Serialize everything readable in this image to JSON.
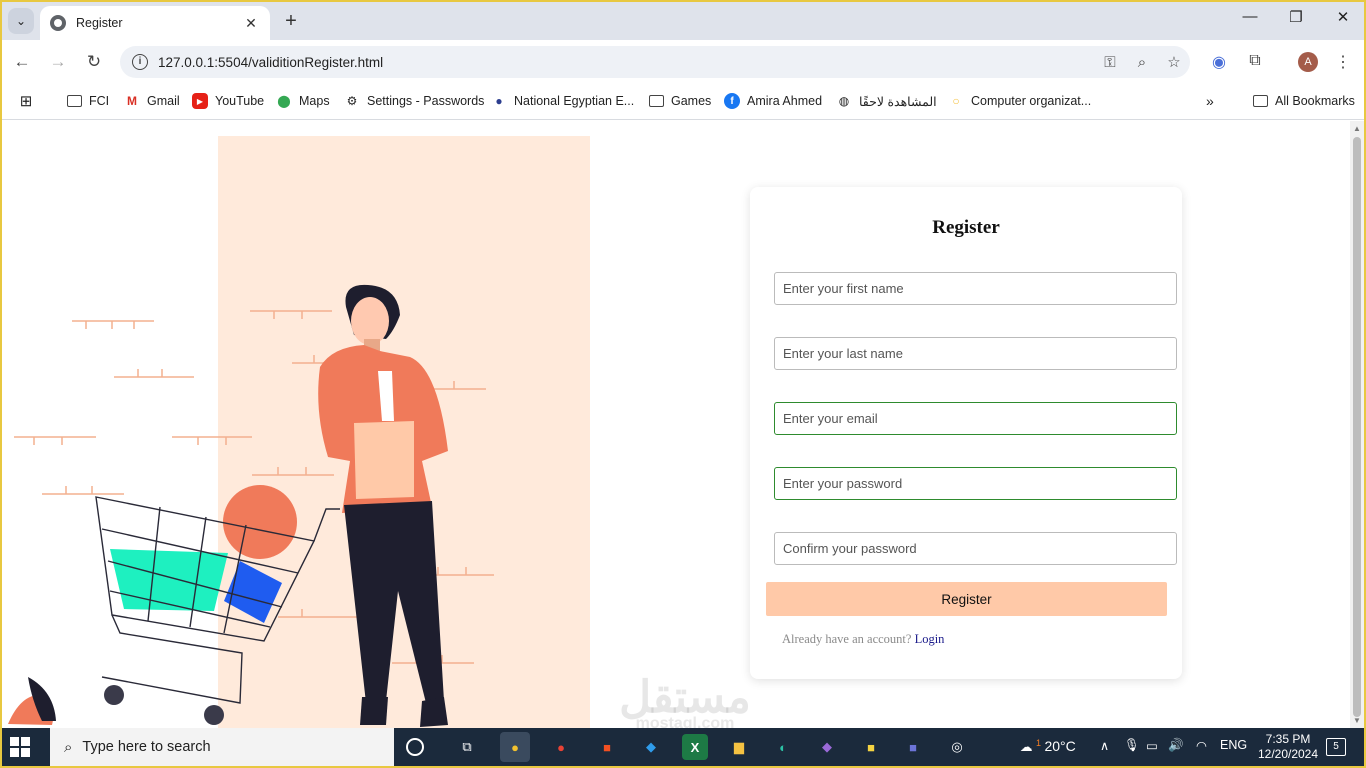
{
  "browser": {
    "tab": {
      "title": "Register"
    },
    "address": {
      "url": "127.0.0.1:5504/validitionRegister.html"
    },
    "profile_initial": "A",
    "bookmarks": [
      {
        "label": "FCI",
        "icon": "folder-icon"
      },
      {
        "label": "Gmail",
        "icon": "gmail-icon"
      },
      {
        "label": "YouTube",
        "icon": "youtube-icon"
      },
      {
        "label": "Maps",
        "icon": "maps-icon"
      },
      {
        "label": "Settings - Passwords",
        "icon": "gear-icon"
      },
      {
        "label": "National Egyptian E...",
        "icon": "site-icon"
      },
      {
        "label": "Games",
        "icon": "folder-icon"
      },
      {
        "label": "Amira Ahmed",
        "icon": "facebook-icon"
      },
      {
        "label": "المشاهدة لاحقًا",
        "icon": "globe-icon"
      },
      {
        "label": "Computer organizat...",
        "icon": "site-icon"
      }
    ],
    "all_bookmarks": "All Bookmarks"
  },
  "form": {
    "title": "Register",
    "first_name_placeholder": "Enter your first name",
    "last_name_placeholder": "Enter your last name",
    "email_placeholder": "Enter your email",
    "password_placeholder": "Enter your password",
    "confirm_placeholder": "Confirm your password",
    "submit_label": "Register",
    "login_prompt": "Already have an account?",
    "login_link": "Login"
  },
  "watermark": {
    "arabic": "مستقل",
    "latin": "mostaql.com"
  },
  "taskbar": {
    "search_placeholder": "Type here to search",
    "weather": "20°C",
    "weather_badge": "1",
    "language": "ENG",
    "time": "7:35 PM",
    "date": "12/20/2024",
    "notification_count": "5"
  },
  "colors": {
    "accent_button": "#ffc9a8",
    "valid_border": "#2e8b2e",
    "panel_bg": "#ffeadb"
  }
}
